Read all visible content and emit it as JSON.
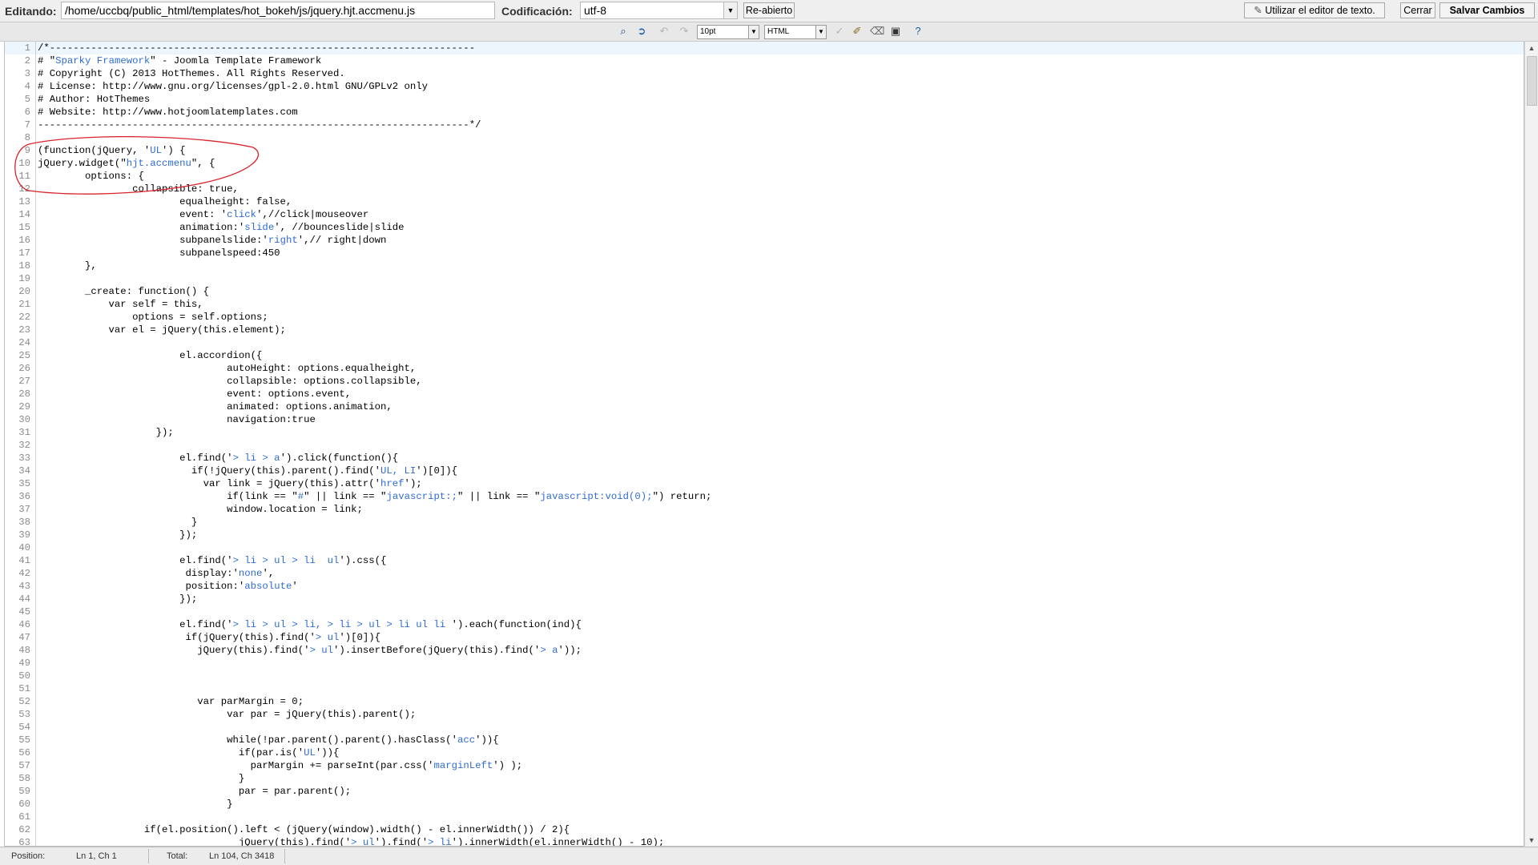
{
  "topbar": {
    "editing_label": "Editando:",
    "file_path": "/home/uccbq/public_html/templates/hot_bokeh/js/jquery.hjt.accmenu.js",
    "encoding_label": "Codificación:",
    "encoding_value": "utf-8",
    "reopen_label": "Re-abierto",
    "use_text_editor_label": "Utilizar el editor de texto.",
    "close_label": "Cerrar",
    "save_label": "Salvar Cambios"
  },
  "toolbar": {
    "font_size": "10pt",
    "syntax": "HTML",
    "icons": [
      "binoculars-search-icon",
      "goto-line-icon",
      "undo-icon",
      "redo-icon",
      "highlight-icon",
      "format-brush-icon",
      "eraser-icon",
      "fullscreen-icon",
      "help-icon"
    ]
  },
  "editor": {
    "active_line": 1,
    "lines": [
      "/*------------------------------------------------------------------------",
      "# \"Sparky Framework\" - Joomla Template Framework",
      "# Copyright (C) 2013 HotThemes. All Rights Reserved.",
      "# License: http://www.gnu.org/licenses/gpl-2.0.html GNU/GPLv2 only",
      "# Author: HotThemes",
      "# Website: http://www.hotjoomlatemplates.com",
      "-------------------------------------------------------------------------*/",
      "",
      "(function(jQuery, 'UL') {",
      "jQuery.widget(\"hjt.accmenu\", {",
      "        options: {",
      "                collapsible: true,",
      "                        equalheight: false,",
      "                        event: 'click',//click|mouseover",
      "                        animation:'slide', //bounceslide|slide",
      "                        subpanelslide:'right',// right|down",
      "                        subpanelspeed:450",
      "        },",
      "",
      "        _create: function() {",
      "            var self = this,",
      "                options = self.options;",
      "            var el = jQuery(this.element);",
      "",
      "                        el.accordion({",
      "                                autoHeight: options.equalheight,",
      "                                collapsible: options.collapsible,",
      "                                event: options.event,",
      "                                animated: options.animation,",
      "                                navigation:true",
      "                    });",
      "",
      "                        el.find('> li > a').click(function(){",
      "                          if(!jQuery(this).parent().find('UL, LI')[0]){",
      "                            var link = jQuery(this).attr('href');",
      "                                if(link == \"#\" || link == \"javascript:;\" || link == \"javascript:void(0);\") return;",
      "                                window.location = link;",
      "                          }",
      "                        });",
      "",
      "                        el.find('> li > ul > li  ul').css({",
      "                         display:'none',",
      "                         position:'absolute'",
      "                        });",
      "",
      "                        el.find('> li > ul > li, > li > ul > li ul li ').each(function(ind){",
      "                         if(jQuery(this).find('> ul')[0]){",
      "                           jQuery(this).find('> ul').insertBefore(jQuery(this).find('> a'));",
      "",
      "",
      "",
      "                           var parMargin = 0;",
      "                                var par = jQuery(this).parent();",
      "",
      "                                while(!par.parent().parent().hasClass('acc')){",
      "                                  if(par.is('UL')){",
      "                                    parMargin += parseInt(par.css('marginLeft') );",
      "                                  }",
      "                                  par = par.parent();",
      "                                }",
      "",
      "                  if(el.position().left < (jQuery(window).width() - el.innerWidth()) / 2){",
      "                                  jQuery(this).find('> ul').find('> li').innerWidth(el.innerWidth() - 10);"
    ]
  },
  "status": {
    "position_label": "Position:",
    "position_value": "Ln 1, Ch 1",
    "total_label": "Total:",
    "total_value": "Ln 104, Ch 3418"
  },
  "colors": {
    "string": "#2f6dd0",
    "annotation": "#d8232a",
    "line_number": "#8b8b8b"
  }
}
